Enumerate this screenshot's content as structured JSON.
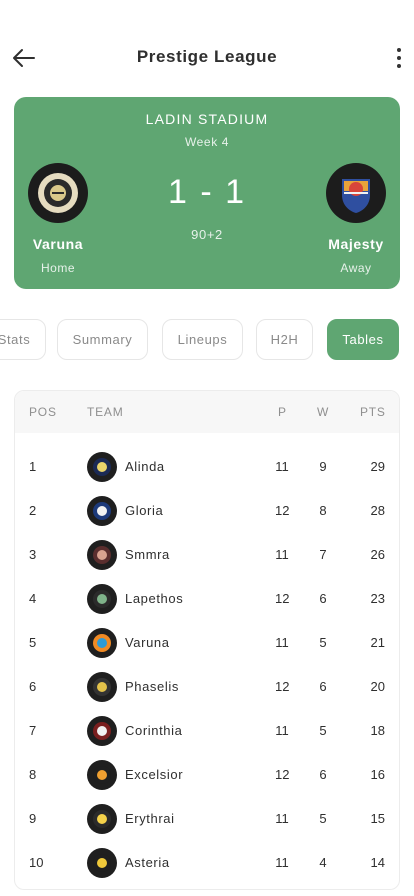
{
  "header": {
    "title": "Prestige League"
  },
  "match": {
    "stadium": "LADIN STADIUM",
    "week": "Week 4",
    "score": "1 - 1",
    "minute": "90+2",
    "home": {
      "name": "Varuna",
      "label": "Home"
    },
    "away": {
      "name": "Majesty",
      "label": "Away"
    }
  },
  "tabs": [
    {
      "label": "Stats"
    },
    {
      "label": "Summary"
    },
    {
      "label": "Lineups"
    },
    {
      "label": "H2H"
    },
    {
      "label": "Tables",
      "active": true
    }
  ],
  "table": {
    "headers": {
      "pos": "POS",
      "team": "TEAM",
      "p": "P",
      "w": "W",
      "pts": "PTS"
    },
    "rows": [
      {
        "pos": "1",
        "team": "Alinda",
        "p": "11",
        "w": "9",
        "pts": "29"
      },
      {
        "pos": "2",
        "team": "Gloria",
        "p": "12",
        "w": "8",
        "pts": "28"
      },
      {
        "pos": "3",
        "team": "Smmra",
        "p": "11",
        "w": "7",
        "pts": "26"
      },
      {
        "pos": "4",
        "team": "Lapethos",
        "p": "12",
        "w": "6",
        "pts": "23"
      },
      {
        "pos": "5",
        "team": "Varuna",
        "p": "11",
        "w": "5",
        "pts": "21"
      },
      {
        "pos": "6",
        "team": "Phaselis",
        "p": "12",
        "w": "6",
        "pts": "20"
      },
      {
        "pos": "7",
        "team": "Corinthia",
        "p": "11",
        "w": "5",
        "pts": "18"
      },
      {
        "pos": "8",
        "team": "Excelsior",
        "p": "12",
        "w": "6",
        "pts": "16"
      },
      {
        "pos": "9",
        "team": "Erythrai",
        "p": "11",
        "w": "5",
        "pts": "15"
      },
      {
        "pos": "10",
        "team": "Asteria",
        "p": "11",
        "w": "4",
        "pts": "14"
      }
    ]
  },
  "theme": {
    "accent": "#5fa672",
    "icon_back": "arrow-left-icon",
    "icon_menu": "more-vertical-icon"
  }
}
